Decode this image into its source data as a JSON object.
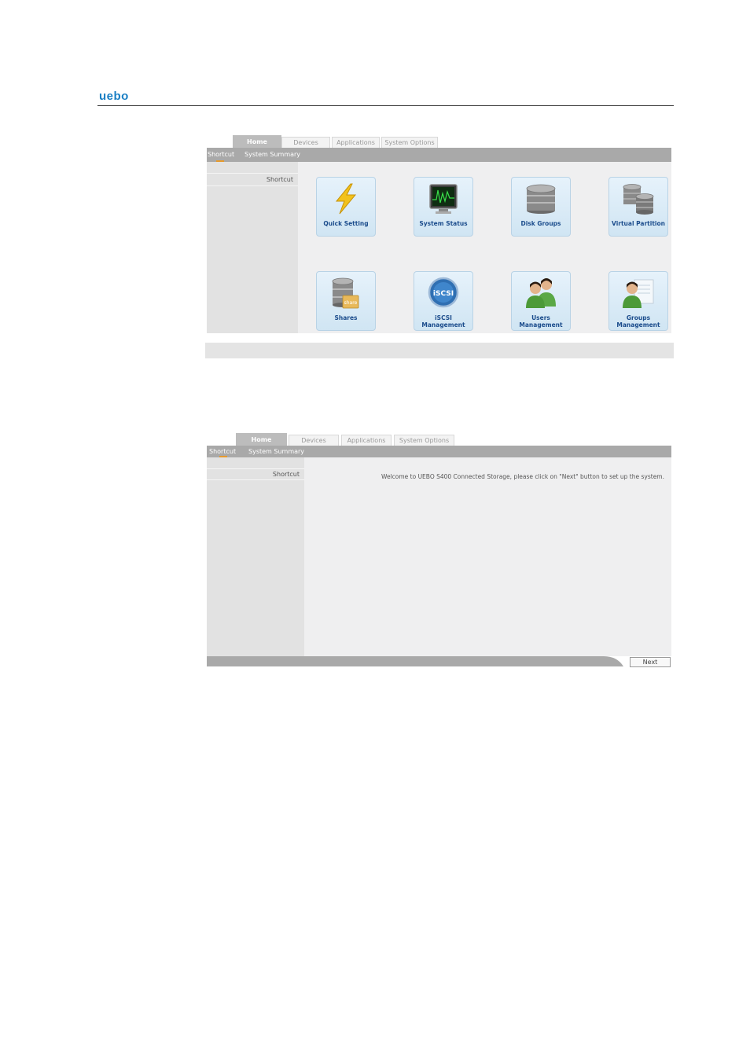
{
  "brand": {
    "logo_text": "uebo"
  },
  "screen1": {
    "tabs": [
      "Home",
      "Devices",
      "Applications",
      "System Options"
    ],
    "subnav": [
      "Shortcut",
      "System Summary"
    ],
    "sidebar_label": "Shortcut",
    "tiles": [
      {
        "label": "Quick Setting",
        "icon": "lightning-icon"
      },
      {
        "label": "System Status",
        "icon": "monitor-icon"
      },
      {
        "label": "Disk Groups",
        "icon": "disk-stack-icon"
      },
      {
        "label": "Virtual Partition",
        "icon": "virtual-partition-icon"
      },
      {
        "label": "Shares",
        "icon": "share-icon",
        "badge": "share"
      },
      {
        "label": "iSCSI\nManagement",
        "icon": "iscsi-icon",
        "badge": "iSCSI"
      },
      {
        "label": "Users\nManagement",
        "icon": "users-icon"
      },
      {
        "label": "Groups\nManagement",
        "icon": "groups-icon"
      }
    ]
  },
  "screen2": {
    "tabs": [
      "Home",
      "Devices",
      "Applications",
      "System Options"
    ],
    "subnav": [
      "Shortcut",
      "System Summary"
    ],
    "sidebar_label": "Shortcut",
    "welcome_text": "Welcome to UEBO S400 Connected Storage, please click on \"Next\" button to set up the system.",
    "next_label": "Next"
  },
  "colors": {
    "brand": "#1a7fc4",
    "tile_label": "#1b4c8c",
    "subnav_bg": "#a9a9a9",
    "active_underline": "#e69a2e"
  }
}
